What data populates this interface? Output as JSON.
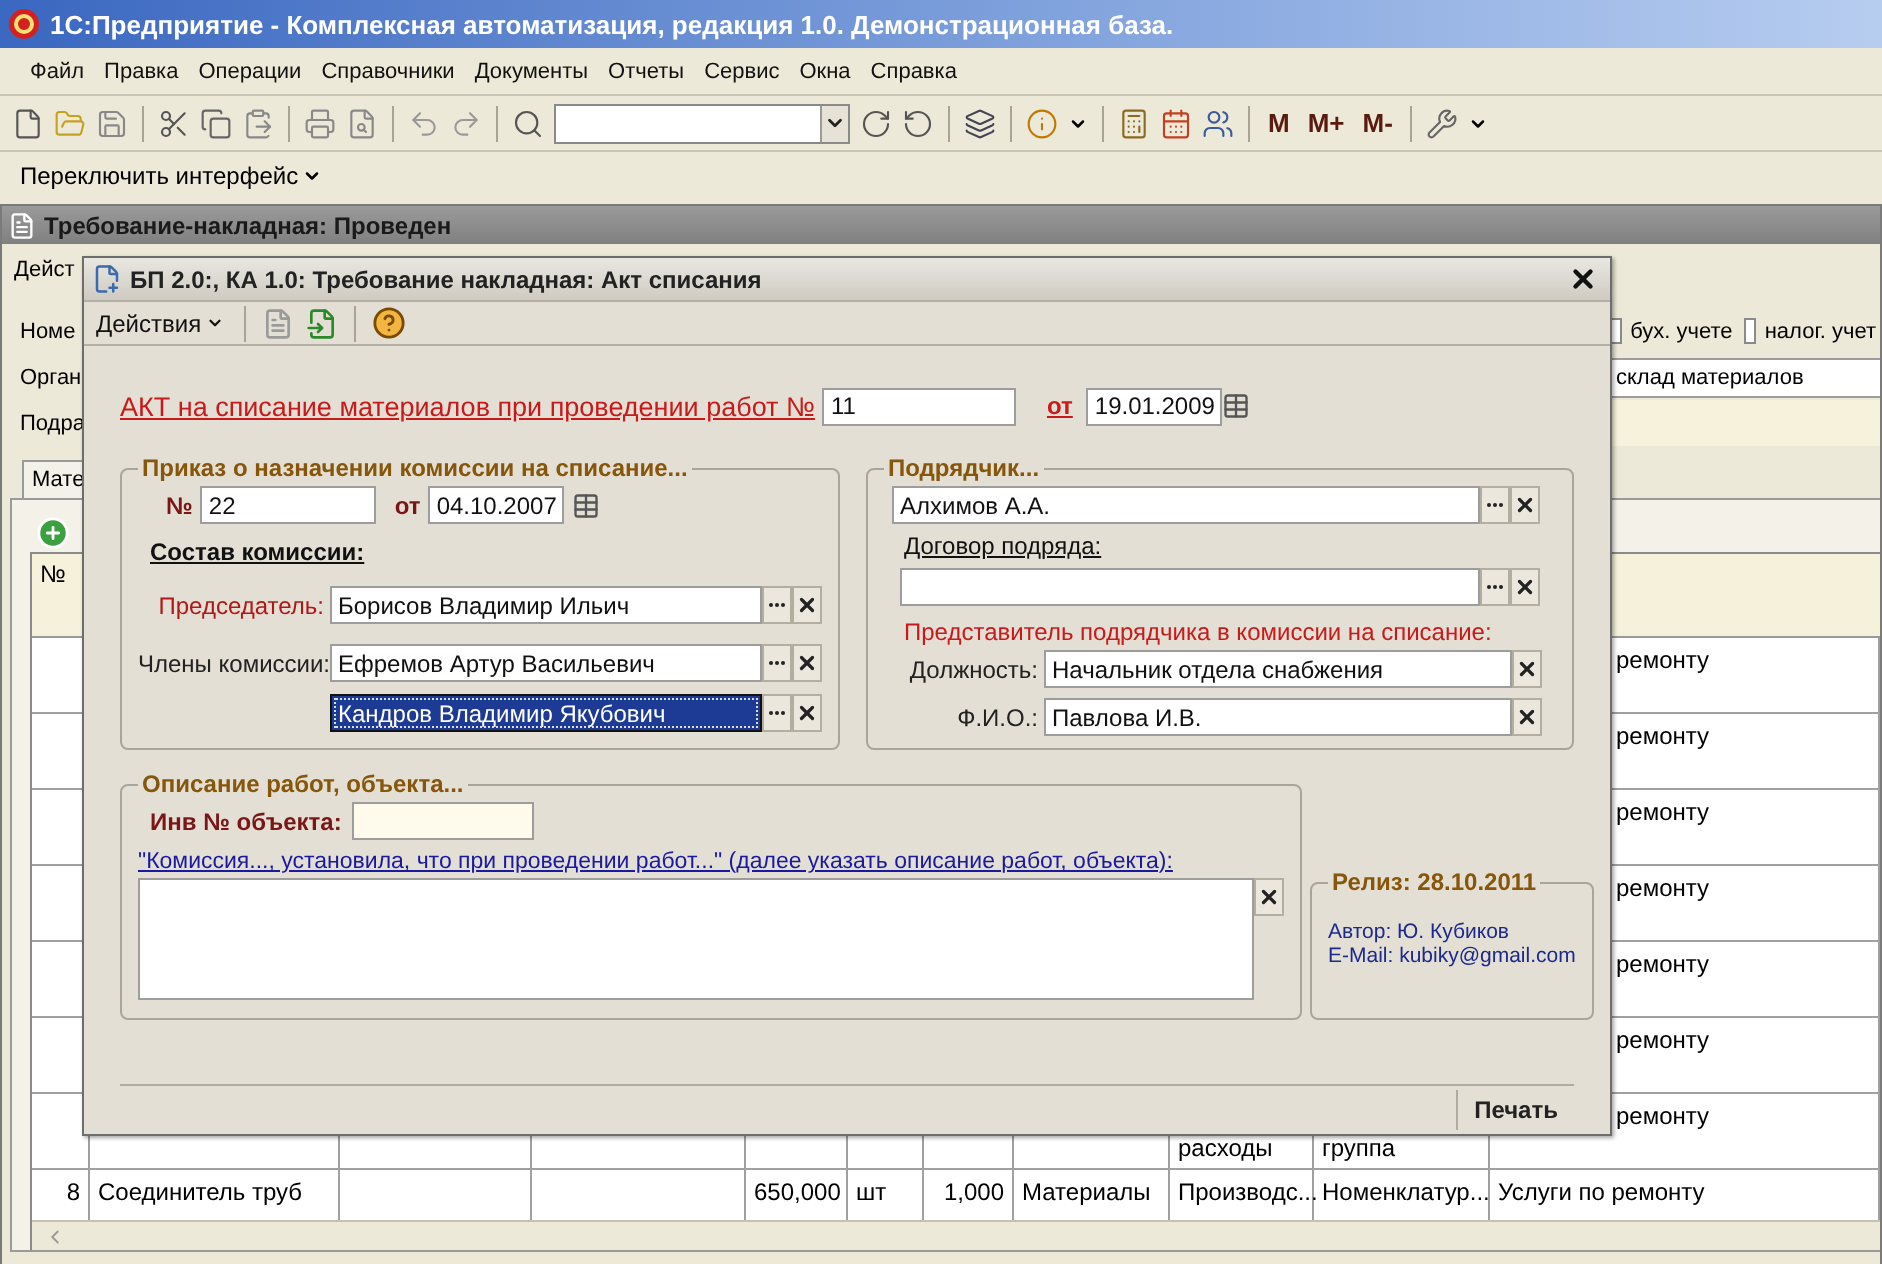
{
  "window": {
    "title": "1С:Предприятие - Комплексная автоматизация, редакция 1.0. Демонстрационная база."
  },
  "menu": [
    {
      "label": "Файл"
    },
    {
      "label": "Правка"
    },
    {
      "label": "Операции"
    },
    {
      "label": "Справочники"
    },
    {
      "label": "Документы"
    },
    {
      "label": "Отчеты"
    },
    {
      "label": "Сервис"
    },
    {
      "label": "Окна"
    },
    {
      "label": "Справка"
    }
  ],
  "toolbar": {
    "memory_buttons": [
      "М",
      "М+",
      "М-"
    ]
  },
  "interface_bar": {
    "label": "Переключить интерфейс"
  },
  "document": {
    "title": "Требование-накладная: Проведен",
    "actions": "Дейст",
    "labels": [
      "Номе",
      "Орган",
      "Подра"
    ],
    "checkboxes": [
      {
        "label": "бух. учете",
        "checked": false
      },
      {
        "label": "налог. учет",
        "checked": false
      }
    ],
    "warehouse": "склад материалов",
    "tab": "Мате",
    "table": {
      "columns": [
        "№"
      ],
      "rows": [
        {
          "covered": true,
          "column_11": "ремонту"
        },
        {
          "covered": true,
          "column_11": "ремонту"
        },
        {
          "covered": true,
          "column_11": "ремонту"
        },
        {
          "covered": true,
          "column_11": "ремонту"
        },
        {
          "covered": true,
          "column_11": "ремонту"
        },
        {
          "covered": true,
          "column_11": "ремонту"
        },
        {
          "covered": true,
          "column_9": "расходы",
          "column_10": "группа",
          "column_11": "ремонту"
        },
        {
          "column_1": "8",
          "column_2": "Соединитель труб",
          "column_5": "650,000",
          "column_6": "шт",
          "column_7": "1,000",
          "column_8": "Материалы",
          "column_9": "Производс...",
          "column_10": "Номенклатур...",
          "column_11": "Услуги по ремонту"
        }
      ]
    }
  },
  "dialog": {
    "title": "БП 2.0:, КА 1.0: Требование накладная: Акт списания",
    "actions_menu": "Действия",
    "act": {
      "label": "АКТ на списание материалов при проведении работ №",
      "number": "11",
      "date_label": "от",
      "date": "19.01.2009"
    },
    "order": {
      "title": "Приказ о назначении комиссии на списание...",
      "number_label": "№",
      "number": "22",
      "date_label": "от",
      "date": "04.10.2007",
      "commission_title": "Состав комиссии:",
      "members": [
        {
          "label": "Председатель:",
          "required": true,
          "value": "Борисов Владимир Ильич",
          "selected": false
        },
        {
          "label": "Члены комиссии:",
          "required": false,
          "value": "Ефремов Артур Васильевич",
          "selected": false
        },
        {
          "value": "Кандров Владимир Якубович",
          "selected": true
        }
      ]
    },
    "contractor": {
      "title": "Подрядчик...",
      "value": "Алхимов А.А.",
      "contract_label": "Договор подряда:",
      "representative_title": "Представитель подрядчика в комиссии на списание:",
      "fields": [
        {
          "label": "Должность:",
          "value": "Начальник отдела снабжения"
        },
        {
          "label": "Ф.И.О.:",
          "value": "Павлова И.В."
        }
      ]
    },
    "description": {
      "title": "Описание работ, объекта...",
      "inventory_label": "Инв № объекта:",
      "hint_link": "\"Комиссия..., установила, что при проведении работ...\" (далее указать описание работ, объекта):"
    },
    "release": {
      "title": "Релиз: 28.10.2011",
      "author": "Автор: Ю. Кубиков",
      "email": "E-Mail: kubiky@gmail.com"
    },
    "print_button": "Печать"
  }
}
